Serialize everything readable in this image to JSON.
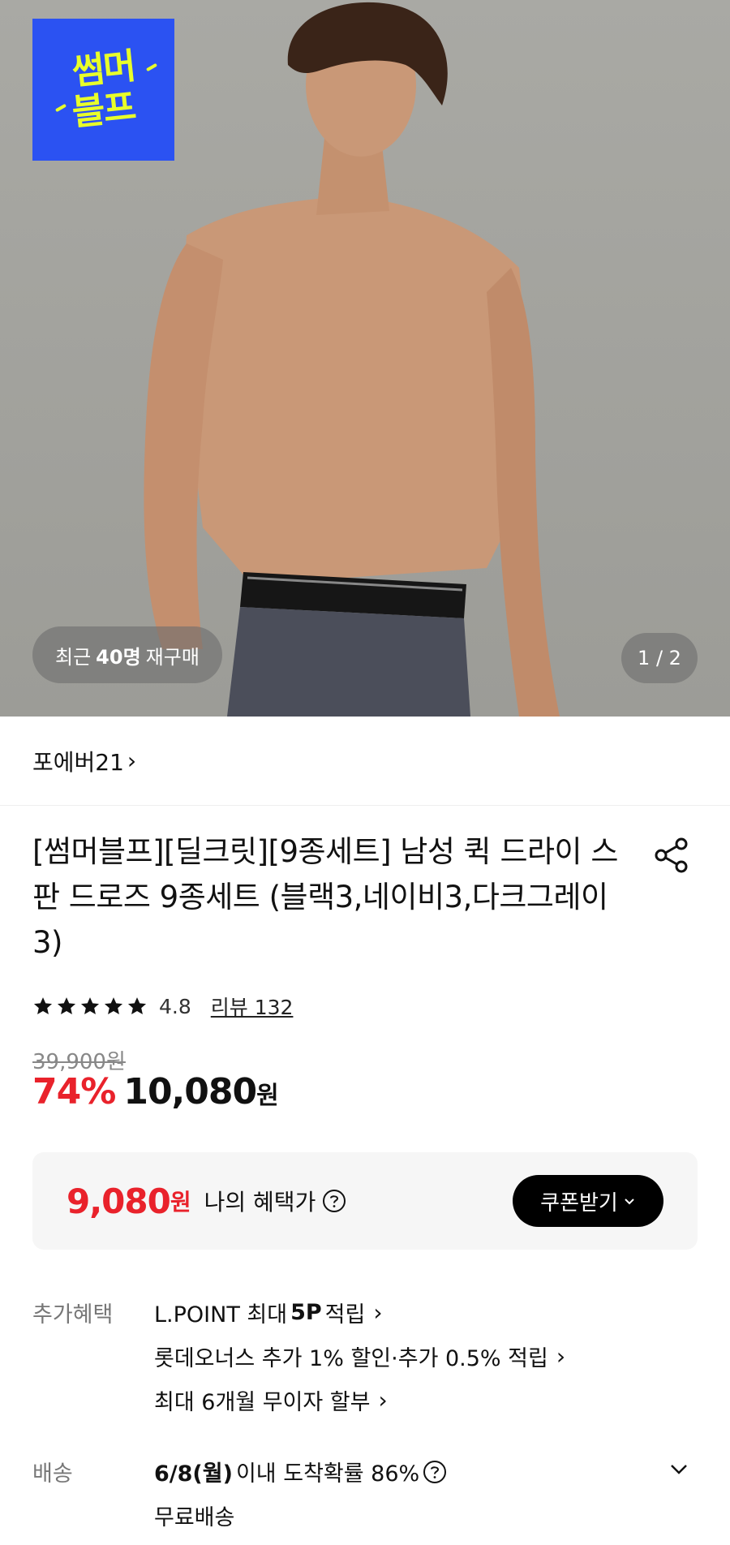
{
  "hero": {
    "promo_line1": "썸머",
    "promo_line2": "블프",
    "rebuy_prefix": "최근",
    "rebuy_count": "40명",
    "rebuy_suffix": "재구매",
    "pager": "1 / 2"
  },
  "brand": {
    "name": "포에버21",
    "chevron": "›"
  },
  "product": {
    "title": "[썸머블프][딜크릿][9종세트] 남성 퀵 드라이 스판 드로즈 9종세트 (블랙3,네이비3,다크그레이3)",
    "rating": "4.8",
    "stars": 5,
    "review_label": "리뷰 132",
    "original_price": "39,900원",
    "discount_rate": "74%",
    "sale_price": "10,080",
    "sale_currency": "원"
  },
  "benefit": {
    "price": "9,080",
    "currency": "원",
    "label": "나의 혜택가",
    "coupon_button": "쿠폰받기"
  },
  "extra_benefits": {
    "label": "추가혜택",
    "line1_pre": "L.POINT 최대",
    "line1_bold": "5P",
    "line1_post": "적립",
    "line2": "롯데오너스 추가 1% 할인·추가 0.5% 적립",
    "line3": "최대 6개월 무이자 할부"
  },
  "delivery": {
    "label": "배송",
    "date_bold": "6/8(월)",
    "date_text": "이내 도착확률 86%",
    "free": "무료배송"
  },
  "colors": {
    "accent_red": "#e9222b",
    "promo_blue": "#2b52f2",
    "promo_yellow": "#e8ff2a"
  },
  "icons": [
    "share-icon",
    "star-icon",
    "help-icon",
    "chevron-right-icon",
    "chevron-down-icon"
  ]
}
